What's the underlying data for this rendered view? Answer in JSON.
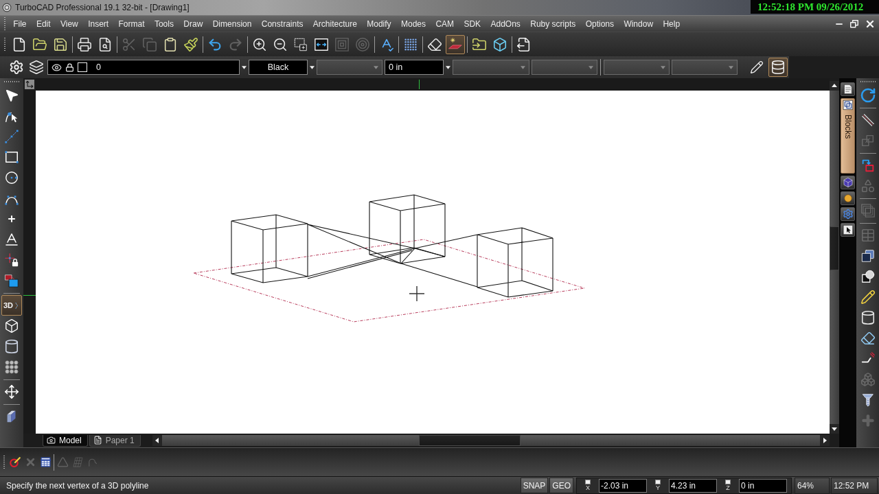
{
  "window": {
    "title": "TurboCAD Professional 19.1 32-bit - [Drawing1]"
  },
  "recording_clock": "12:52:18 PM 09/26/2012",
  "menu": [
    "File",
    "Edit",
    "View",
    "Insert",
    "Format",
    "Tools",
    "Draw",
    "Dimension",
    "Constraints",
    "Architecture",
    "Modify",
    "Modes",
    "CAM",
    "SDK",
    "AddOns",
    "Ruby scripts",
    "Options",
    "Window",
    "Help"
  ],
  "standard_toolbar": [
    [
      {
        "kind": "new",
        "disabled": false,
        "selected": false
      },
      {
        "kind": "open",
        "disabled": false,
        "selected": false
      },
      {
        "kind": "save",
        "disabled": false,
        "selected": false
      }
    ],
    [
      {
        "kind": "print",
        "disabled": false,
        "selected": false
      },
      {
        "kind": "preview",
        "disabled": false,
        "selected": false
      }
    ],
    [
      {
        "kind": "cut",
        "disabled": true,
        "selected": false
      },
      {
        "kind": "copy",
        "disabled": true,
        "selected": false
      },
      {
        "kind": "paste",
        "disabled": false,
        "selected": false
      },
      {
        "kind": "brush",
        "disabled": false,
        "selected": false
      }
    ],
    [
      {
        "kind": "undo",
        "disabled": false,
        "selected": false
      },
      {
        "kind": "redo",
        "disabled": true,
        "selected": false
      }
    ],
    [
      {
        "kind": "zoomin",
        "disabled": false,
        "selected": false
      },
      {
        "kind": "zoomout",
        "disabled": false,
        "selected": false
      },
      {
        "kind": "zoomwindow",
        "disabled": false,
        "selected": false
      },
      {
        "kind": "zoomextents",
        "disabled": false,
        "selected": false
      },
      {
        "kind": "zoomprevious",
        "disabled": true,
        "selected": false
      },
      {
        "kind": "zoomrotate",
        "disabled": true,
        "selected": false
      }
    ],
    [
      {
        "kind": "spelling",
        "disabled": false,
        "selected": false
      }
    ],
    [
      {
        "kind": "grid",
        "disabled": false,
        "selected": false
      }
    ],
    [
      {
        "kind": "eraser",
        "disabled": false,
        "selected": false
      },
      {
        "kind": "workplane",
        "disabled": false,
        "selected": true
      }
    ],
    [
      {
        "kind": "import",
        "disabled": false,
        "selected": false
      },
      {
        "kind": "cube",
        "disabled": false,
        "selected": false
      }
    ],
    [
      {
        "kind": "export",
        "disabled": false,
        "selected": false
      }
    ]
  ],
  "property_bar": {
    "field_groups": [
      [
        {
          "kind": "layer",
          "value": "0",
          "disabled": false
        },
        {
          "kind": "color",
          "value": "Black",
          "disabled": false
        },
        {
          "kind": "select",
          "disabled": true
        },
        {
          "kind": "measure",
          "value": "0 in",
          "disabled": false
        },
        {
          "kind": "select",
          "disabled": true
        },
        {
          "kind": "select",
          "disabled": true
        }
      ],
      [
        {
          "kind": "select",
          "disabled": true
        },
        {
          "kind": "select",
          "disabled": true
        }
      ]
    ],
    "tools": [
      {
        "kind": "pen",
        "selected": false
      },
      {
        "kind": "stack",
        "selected": true
      }
    ]
  },
  "left_toolbar": [
    [
      {
        "kind": "select",
        "selected": false
      },
      {
        "kind": "nodeedit",
        "selected": false
      },
      {
        "kind": "line",
        "selected": false
      },
      {
        "kind": "rectangle",
        "selected": false
      },
      {
        "kind": "circle",
        "selected": false
      },
      {
        "kind": "arc",
        "selected": false
      },
      {
        "kind": "point",
        "selected": false
      },
      {
        "kind": "text",
        "selected": false
      },
      {
        "kind": "snaplock",
        "selected": false
      },
      {
        "kind": "colors",
        "selected": false
      }
    ],
    [
      {
        "kind": "polyline3d",
        "label": "3D",
        "selected": true
      },
      {
        "kind": "box",
        "selected": false
      },
      {
        "kind": "cylinder",
        "selected": false
      },
      {
        "kind": "array",
        "selected": false
      }
    ],
    [
      {
        "kind": "move",
        "selected": false
      }
    ],
    [
      {
        "kind": "extrude",
        "selected": false
      }
    ]
  ],
  "drawing_tabs": [
    {
      "kind": "model",
      "label": "Model",
      "selected": true
    },
    {
      "kind": "paper",
      "label": "Paper 1",
      "selected": false
    }
  ],
  "dock_tabs": [
    {
      "kind": "properties",
      "selected": false
    },
    {
      "kind": "blocks",
      "label": "Blocks",
      "selected": true
    },
    {
      "kind": "materials",
      "selected": false
    },
    {
      "kind": "render",
      "selected": false
    },
    {
      "kind": "gears",
      "selected": false
    },
    {
      "kind": "selector",
      "selected": false
    }
  ],
  "right_toolbar": [
    [
      {
        "kind": "rotate",
        "disabled": false
      }
    ],
    [
      {
        "kind": "parallel",
        "disabled": false
      },
      {
        "kind": "offset",
        "disabled": true
      }
    ],
    [
      {
        "kind": "copyto",
        "disabled": false
      },
      {
        "kind": "shapes",
        "disabled": true
      }
    ],
    [
      {
        "kind": "overlap",
        "disabled": true
      }
    ],
    [
      {
        "kind": "table",
        "disabled": true
      },
      {
        "kind": "boolean",
        "disabled": false
      },
      {
        "kind": "sphere",
        "disabled": false
      },
      {
        "kind": "pencil",
        "disabled": false
      },
      {
        "kind": "cylinder",
        "disabled": false
      },
      {
        "kind": "eraser",
        "disabled": false
      },
      {
        "kind": "bend",
        "disabled": false
      },
      {
        "kind": "boxes",
        "disabled": true
      },
      {
        "kind": "screw",
        "disabled": false
      },
      {
        "kind": "plus",
        "disabled": true
      }
    ]
  ],
  "bottom_toolbar": [
    [
      {
        "kind": "snaptool",
        "disabled": false
      },
      {
        "kind": "cancel",
        "disabled": true
      },
      {
        "kind": "table",
        "disabled": false
      }
    ],
    [
      {
        "kind": "triangle",
        "disabled": true
      },
      {
        "kind": "checker",
        "disabled": true
      },
      {
        "kind": "hook",
        "disabled": true
      }
    ]
  ],
  "status_bar": {
    "prompt": "Specify the next vertex of a 3D polyline",
    "toggles": [
      "SNAP",
      "GEO"
    ],
    "coordinates": [
      {
        "axis": "X",
        "value": "-2.03 in"
      },
      {
        "axis": "Y",
        "value": "4.23 in"
      },
      {
        "axis": "Z",
        "value": "0 in"
      }
    ],
    "zoom": "64%",
    "time": "12:52 PM"
  }
}
